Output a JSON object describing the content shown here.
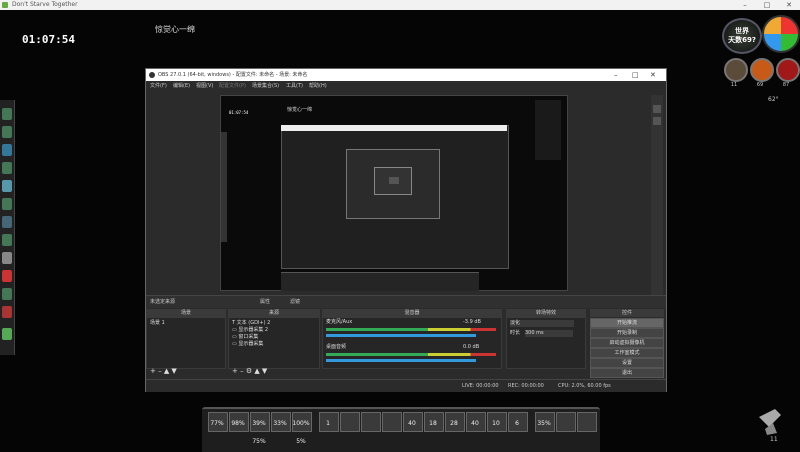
{
  "window": {
    "title": "Don't Starve Together"
  },
  "clock": "01:07:54",
  "game_title": "惊觉心一绵",
  "hud": {
    "world_label": "世界",
    "world_days": "天数69?",
    "stats": [
      {
        "name": "hunger",
        "value": "11",
        "color": "#8a7a5a"
      },
      {
        "name": "sanity",
        "value": "69",
        "color": "#e06a20"
      },
      {
        "name": "health",
        "value": "87",
        "color": "#c02020"
      }
    ],
    "temperature": "62°"
  },
  "obs": {
    "title": "OBS 27.0.1 (64-bit, windows) - 配置文件: 未命名 - 场景: 未命名",
    "menu": [
      "文件(F)",
      "编辑(E)",
      "视图(V)",
      "配置文件(P)",
      "场景集合(S)",
      "工具(T)",
      "帮助(H)"
    ],
    "nested_game_title": "惊觉心一绵",
    "nested_clock": "01:07:54",
    "source_bar": {
      "label": "未选定来源",
      "properties": "属性",
      "filters": "滤镜"
    },
    "panels": {
      "scenes": {
        "title": "场景",
        "items": [
          "场景 1"
        ]
      },
      "sources": {
        "title": "来源",
        "items": [
          "文本 (GDI+) 2",
          "显示器采集 2",
          "窗口采集",
          "显示器采集"
        ]
      },
      "mixer": {
        "title": "混音器",
        "channels": [
          {
            "name": "麦克风/Aux",
            "db": "-3.9 dB"
          },
          {
            "name": "桌面音频",
            "db": "0.0 dB"
          }
        ]
      },
      "transitions": {
        "title": "转场特效",
        "type": "淡化",
        "duration_label": "时长",
        "duration": "300 ms"
      },
      "controls": {
        "title": "控件",
        "buttons": [
          "开始推流",
          "开始录制",
          "启动虚拟摄像机",
          "工作室模式",
          "设置",
          "退出"
        ]
      }
    },
    "status": {
      "live": "LIVE: 00:00:00",
      "rec": "REC: 00:00:00",
      "cpu": "CPU: 2.0%, 60.00 fps"
    }
  },
  "hotbar": {
    "slots": [
      {
        "label": "77%"
      },
      {
        "label": "98%"
      },
      {
        "label": "39%"
      },
      {
        "label": "33%"
      },
      {
        "label": "100%"
      },
      {
        "label": "1"
      },
      {
        "label": ""
      },
      {
        "label": ""
      },
      {
        "label": ""
      },
      {
        "label": "40"
      },
      {
        "label": "18"
      },
      {
        "label": "28"
      },
      {
        "label": "40"
      },
      {
        "label": "10"
      },
      {
        "label": "6"
      },
      {
        "label": "35%"
      },
      {
        "label": ""
      },
      {
        "label": ""
      }
    ],
    "sub_labels": [
      "75%",
      "5%"
    ]
  },
  "corner_count": "11"
}
